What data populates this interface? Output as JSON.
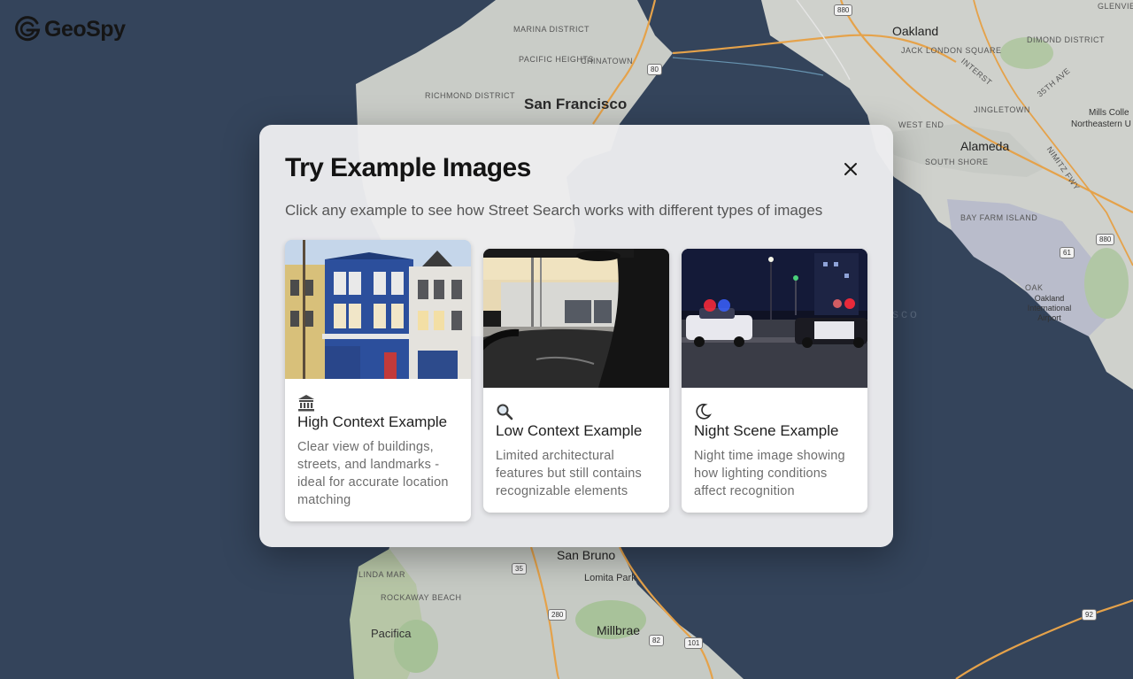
{
  "app": {
    "logo_text": "GeoSpy"
  },
  "map": {
    "labels": {
      "san_francisco": "San Francisco",
      "oakland": "Oakland",
      "alameda": "Alameda",
      "san_bruno": "San Bruno",
      "millbrae": "Millbrae",
      "pacifica": "Pacifica",
      "lomita_park": "Lomita Park",
      "mills_college": "Mills Colle",
      "northeastern": "Northeastern U",
      "marina": "MARINA DISTRICT",
      "pacific_heights": "PACIFIC HEIGHTS",
      "chinatown": "CHINATOWN",
      "richmond": "RICHMOND DISTRICT",
      "jack_london": "JACK LONDON SQUARE",
      "dimond": "DIMOND DISTRICT",
      "glenview": "GLENVIEW",
      "jingletown": "JINGLETOWN",
      "west_end": "WEST END",
      "south_shore": "SOUTH SHORE",
      "bay_farm": "BAY FARM ISLAND",
      "oak_airport": "Oakland International Airport",
      "oak": "OAK",
      "linda_mar": "LINDA MAR",
      "rockaway": "ROCKAWAY BEACH",
      "water_sfo": "sco",
      "street_35th": "35th Ave",
      "nimitz": "Nimitz Fwy",
      "interstate": "Interst"
    },
    "shields": [
      "880",
      "80",
      "61",
      "880",
      "35",
      "280",
      "82",
      "101",
      "92"
    ]
  },
  "modal": {
    "title": "Try Example Images",
    "subtitle": "Click any example to see how Street Search works with different types of images",
    "close_icon": "close-icon"
  },
  "examples": [
    {
      "icon": "classical-building-icon",
      "title": "High Context Example",
      "description": "Clear view of buildings, streets, and landmarks - ideal for accurate location matching"
    },
    {
      "icon": "magnifying-glass-icon",
      "title": "Low Context Example",
      "description": "Limited architectural features but still contains recognizable elements"
    },
    {
      "icon": "crescent-moon-icon",
      "title": "Night Scene Example",
      "description": "Night time image showing how lighting conditions affect recognition"
    }
  ]
}
